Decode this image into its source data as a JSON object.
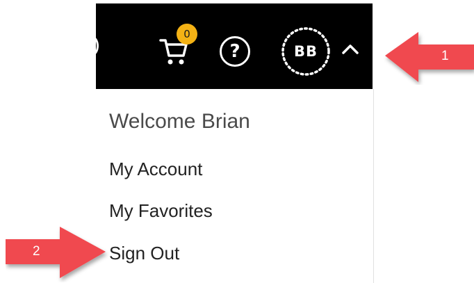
{
  "header": {
    "cart": {
      "icon": "shopping-cart-icon",
      "badge_count": "0",
      "badge_color": "#f4b215"
    },
    "help": {
      "icon": "help-icon",
      "label": "?"
    },
    "avatar": {
      "initials": "BB"
    },
    "toggle": {
      "icon": "chevron-up-icon"
    }
  },
  "menu": {
    "welcome": "Welcome Brian",
    "items": [
      {
        "label": "My Account"
      },
      {
        "label": "My Favorites"
      },
      {
        "label": "Sign Out"
      }
    ]
  },
  "annotations": [
    {
      "label": "1",
      "color": "#f0484f"
    },
    {
      "label": "2",
      "color": "#f0484f"
    }
  ]
}
